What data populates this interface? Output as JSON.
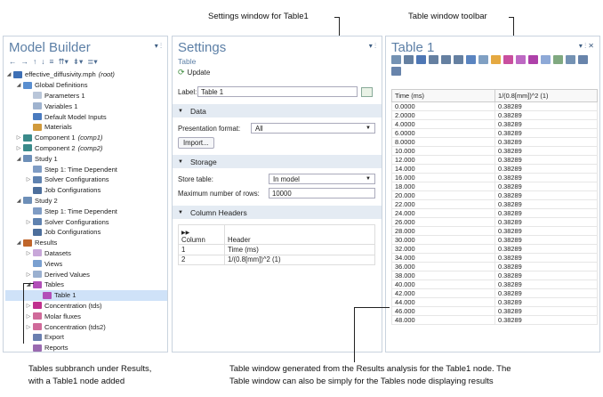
{
  "callouts": {
    "settings_window": "Settings window for Table1",
    "table_toolbar": "Table window toolbar",
    "tables_subbranch_line1": "Tables subbranch under Results,",
    "tables_subbranch_line2": "with a Table1 node added",
    "table_window_line1": "Table window generated from the Results analysis for the Table1 node. The",
    "table_window_line2": "Table window can also be simply for the Tables node displaying results"
  },
  "model_builder": {
    "title": "Model Builder",
    "title_controls": "▾ ⫶",
    "toolbar": [
      "←",
      "→",
      "↑",
      "↓",
      "≡",
      "⇈▾",
      "⇟▾",
      "≣▾"
    ],
    "tree": [
      {
        "label": "effective_diffusivity.mph",
        "tag": "(root)",
        "indent": 0,
        "tw": "◢",
        "color": "#3d6fb5"
      },
      {
        "label": "Global Definitions",
        "tag": "",
        "indent": 1,
        "tw": "◢",
        "color": "#5a8fd0"
      },
      {
        "label": "Parameters 1",
        "tag": "",
        "indent": 2,
        "tw": "",
        "color": "#b9c6d9"
      },
      {
        "label": "Variables 1",
        "tag": "",
        "indent": 2,
        "tw": "",
        "color": "#9fb3cf"
      },
      {
        "label": "Default Model Inputs",
        "tag": "",
        "indent": 2,
        "tw": "",
        "color": "#4a7bbf"
      },
      {
        "label": "Materials",
        "tag": "",
        "indent": 2,
        "tw": "",
        "color": "#d19a3c"
      },
      {
        "label": "Component 1",
        "tag": "(comp1)",
        "indent": 1,
        "tw": "▷",
        "color": "#3a8a8a"
      },
      {
        "label": "Component 2",
        "tag": "(comp2)",
        "indent": 1,
        "tw": "▷",
        "color": "#3a8a8a"
      },
      {
        "label": "Study 1",
        "tag": "",
        "indent": 1,
        "tw": "◢",
        "color": "#6d8fb8"
      },
      {
        "label": "Step 1: Time Dependent",
        "tag": "",
        "indent": 2,
        "tw": "",
        "color": "#7f9cc4"
      },
      {
        "label": "Solver Configurations",
        "tag": "",
        "indent": 2,
        "tw": "▷",
        "color": "#5f82b0"
      },
      {
        "label": "Job Configurations",
        "tag": "",
        "indent": 2,
        "tw": "",
        "color": "#4d6f9c"
      },
      {
        "label": "Study 2",
        "tag": "",
        "indent": 1,
        "tw": "◢",
        "color": "#6d8fb8"
      },
      {
        "label": "Step 1: Time Dependent",
        "tag": "",
        "indent": 2,
        "tw": "",
        "color": "#7f9cc4"
      },
      {
        "label": "Solver Configurations",
        "tag": "",
        "indent": 2,
        "tw": "▷",
        "color": "#5f82b0"
      },
      {
        "label": "Job Configurations",
        "tag": "",
        "indent": 2,
        "tw": "",
        "color": "#4d6f9c"
      },
      {
        "label": "Results",
        "tag": "",
        "indent": 1,
        "tw": "◢",
        "color": "#c0652a"
      },
      {
        "label": "Datasets",
        "tag": "",
        "indent": 2,
        "tw": "▷",
        "color": "#c8a7d9"
      },
      {
        "label": "Views",
        "tag": "",
        "indent": 2,
        "tw": "",
        "color": "#7aa0d0"
      },
      {
        "label": "Derived Values",
        "tag": "",
        "indent": 2,
        "tw": "▷",
        "color": "#9ab0d0"
      },
      {
        "label": "Tables",
        "tag": "",
        "indent": 2,
        "tw": "◢",
        "color": "#b24fb8"
      },
      {
        "label": "Table 1",
        "tag": "",
        "indent": 3,
        "tw": "",
        "color": "#b24fb8",
        "selected": true
      },
      {
        "label": "Concentration (tds)",
        "tag": "",
        "indent": 2,
        "tw": "▷",
        "color": "#c0308e"
      },
      {
        "label": "Molar fluxes",
        "tag": "",
        "indent": 2,
        "tw": "▷",
        "color": "#d06a9a"
      },
      {
        "label": "Concentration (tds2)",
        "tag": "",
        "indent": 2,
        "tw": "▷",
        "color": "#d06a9a"
      },
      {
        "label": "Export",
        "tag": "",
        "indent": 2,
        "tw": "",
        "color": "#6a7fb0"
      },
      {
        "label": "Reports",
        "tag": "",
        "indent": 2,
        "tw": "",
        "color": "#9a6ab0"
      }
    ]
  },
  "settings": {
    "title": "Settings",
    "title_controls": "▾ ⫶",
    "subtitle": "Table",
    "update_label": "Update",
    "label_caption": "Label:",
    "label_value": "Table 1",
    "data_section": "Data",
    "presentation_format_caption": "Presentation format:",
    "presentation_format_value": "All",
    "import_button": "Import...",
    "storage_section": "Storage",
    "store_table_caption": "Store table:",
    "store_table_value": "In model",
    "max_rows_caption": "Maximum number of rows:",
    "max_rows_value": "10000",
    "column_headers_section": "Column Headers",
    "column_headers_table": {
      "headers": [
        "Column",
        "Header"
      ],
      "rows": [
        [
          "1",
          "Time (ms)"
        ],
        [
          "2",
          "1/(0.8[mm])^2 (1)"
        ]
      ]
    }
  },
  "table_window": {
    "title": "Table 1",
    "title_controls": "▾ ⫶ ✕",
    "toolbar_icons": [
      "table-icon",
      "format-8-85-icon",
      "format-auto-icon",
      "format-8-5-icon",
      "format-850-icon",
      "format-0-85-icon",
      "grid-icon",
      "settings-icon",
      "brush-icon",
      "delete-icon",
      "column-icon",
      "color-icon",
      "plot-icon",
      "copy-icon",
      "export-icon",
      "layout-icon",
      "dropdown-icon"
    ],
    "columns": [
      "Time (ms)",
      "1/(0.8[mm])^2 (1)"
    ],
    "rows": [
      [
        "0.0000",
        "0.38289"
      ],
      [
        "2.0000",
        "0.38289"
      ],
      [
        "4.0000",
        "0.38289"
      ],
      [
        "6.0000",
        "0.38289"
      ],
      [
        "8.0000",
        "0.38289"
      ],
      [
        "10.000",
        "0.38289"
      ],
      [
        "12.000",
        "0.38289"
      ],
      [
        "14.000",
        "0.38289"
      ],
      [
        "16.000",
        "0.38289"
      ],
      [
        "18.000",
        "0.38289"
      ],
      [
        "20.000",
        "0.38289"
      ],
      [
        "22.000",
        "0.38289"
      ],
      [
        "24.000",
        "0.38289"
      ],
      [
        "26.000",
        "0.38289"
      ],
      [
        "28.000",
        "0.38289"
      ],
      [
        "30.000",
        "0.38289"
      ],
      [
        "32.000",
        "0.38289"
      ],
      [
        "34.000",
        "0.38289"
      ],
      [
        "36.000",
        "0.38289"
      ],
      [
        "38.000",
        "0.38289"
      ],
      [
        "40.000",
        "0.38289"
      ],
      [
        "42.000",
        "0.38289"
      ],
      [
        "44.000",
        "0.38289"
      ],
      [
        "46.000",
        "0.38289"
      ],
      [
        "48.000",
        "0.38289"
      ]
    ]
  }
}
